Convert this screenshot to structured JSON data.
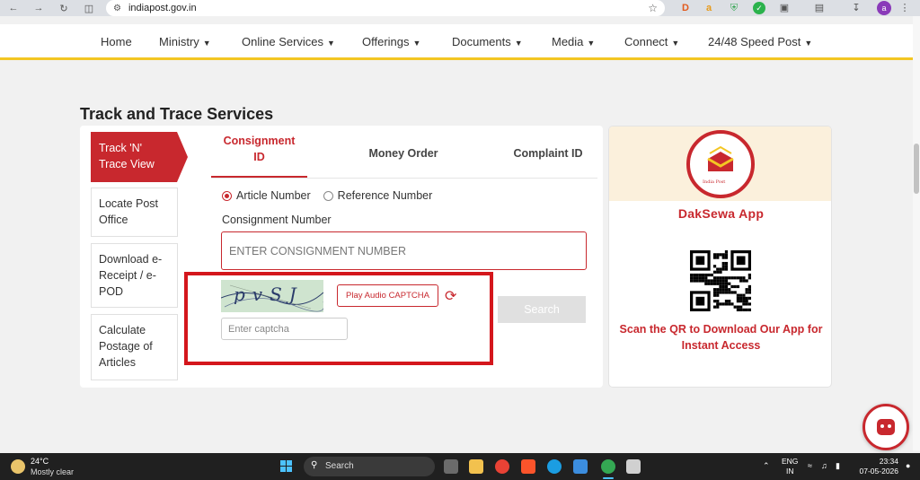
{
  "browser": {
    "url": "indiapost.gov.in",
    "profile_initial": "a"
  },
  "navbar": {
    "items": [
      {
        "label": "Home",
        "dropdown": false
      },
      {
        "label": "Ministry",
        "dropdown": true
      },
      {
        "label": "Online Services",
        "dropdown": true
      },
      {
        "label": "Offerings",
        "dropdown": true
      },
      {
        "label": "Documents",
        "dropdown": true
      },
      {
        "label": "Media",
        "dropdown": true
      },
      {
        "label": "Connect",
        "dropdown": true
      },
      {
        "label": "24/48 Speed Post",
        "dropdown": true
      }
    ]
  },
  "page_title": "Track and Trace Services",
  "sidebar": {
    "items": [
      {
        "label": "Track 'N' Trace View",
        "active": true
      },
      {
        "label": "Locate Post Office",
        "active": false
      },
      {
        "label": "Download e-Receipt / e-POD",
        "active": false
      },
      {
        "label": "Calculate Postage of Articles",
        "active": false
      }
    ]
  },
  "tabs": [
    {
      "label": "Consignment ID",
      "active": true
    },
    {
      "label": "Money Order",
      "active": false
    },
    {
      "label": "Complaint ID",
      "active": false
    }
  ],
  "search_type": {
    "options": [
      "Article Number",
      "Reference Number"
    ],
    "selected": "Article Number"
  },
  "consignment": {
    "label": "Consignment Number",
    "placeholder": "ENTER CONSIGNMENT NUMBER",
    "value": ""
  },
  "captcha": {
    "image_text": "pvSJ",
    "play_audio_label": "Play Audio CAPTCHA",
    "input_placeholder": "Enter captcha",
    "input_value": ""
  },
  "search_button": "Search",
  "dak_sewa": {
    "logo_text": "India Post",
    "title": "DakSewa App",
    "description": "Scan the QR to Download Our App for Instant Access"
  },
  "taskbar": {
    "weather_temp": "24°C",
    "weather_desc": "Mostly clear",
    "search_label": "Search",
    "lang_line1": "ENG",
    "lang_line2": "IN",
    "time": "23:34",
    "date": "07-05-2026"
  },
  "colors": {
    "accent": "#c8282e",
    "nav_border": "#f3c623",
    "highlight_box": "#d4161c"
  }
}
